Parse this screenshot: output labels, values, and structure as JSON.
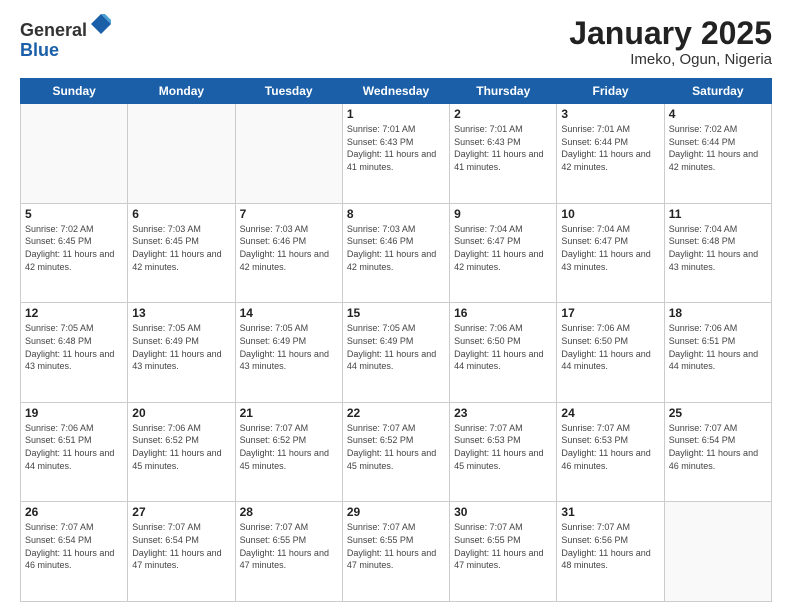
{
  "header": {
    "logo_general": "General",
    "logo_blue": "Blue",
    "title": "January 2025",
    "subtitle": "Imeko, Ogun, Nigeria"
  },
  "weekdays": [
    "Sunday",
    "Monday",
    "Tuesday",
    "Wednesday",
    "Thursday",
    "Friday",
    "Saturday"
  ],
  "weeks": [
    [
      {
        "day": "",
        "info": ""
      },
      {
        "day": "",
        "info": ""
      },
      {
        "day": "",
        "info": ""
      },
      {
        "day": "1",
        "info": "Sunrise: 7:01 AM\nSunset: 6:43 PM\nDaylight: 11 hours\nand 41 minutes."
      },
      {
        "day": "2",
        "info": "Sunrise: 7:01 AM\nSunset: 6:43 PM\nDaylight: 11 hours\nand 41 minutes."
      },
      {
        "day": "3",
        "info": "Sunrise: 7:01 AM\nSunset: 6:44 PM\nDaylight: 11 hours\nand 42 minutes."
      },
      {
        "day": "4",
        "info": "Sunrise: 7:02 AM\nSunset: 6:44 PM\nDaylight: 11 hours\nand 42 minutes."
      }
    ],
    [
      {
        "day": "5",
        "info": "Sunrise: 7:02 AM\nSunset: 6:45 PM\nDaylight: 11 hours\nand 42 minutes."
      },
      {
        "day": "6",
        "info": "Sunrise: 7:03 AM\nSunset: 6:45 PM\nDaylight: 11 hours\nand 42 minutes."
      },
      {
        "day": "7",
        "info": "Sunrise: 7:03 AM\nSunset: 6:46 PM\nDaylight: 11 hours\nand 42 minutes."
      },
      {
        "day": "8",
        "info": "Sunrise: 7:03 AM\nSunset: 6:46 PM\nDaylight: 11 hours\nand 42 minutes."
      },
      {
        "day": "9",
        "info": "Sunrise: 7:04 AM\nSunset: 6:47 PM\nDaylight: 11 hours\nand 42 minutes."
      },
      {
        "day": "10",
        "info": "Sunrise: 7:04 AM\nSunset: 6:47 PM\nDaylight: 11 hours\nand 43 minutes."
      },
      {
        "day": "11",
        "info": "Sunrise: 7:04 AM\nSunset: 6:48 PM\nDaylight: 11 hours\nand 43 minutes."
      }
    ],
    [
      {
        "day": "12",
        "info": "Sunrise: 7:05 AM\nSunset: 6:48 PM\nDaylight: 11 hours\nand 43 minutes."
      },
      {
        "day": "13",
        "info": "Sunrise: 7:05 AM\nSunset: 6:49 PM\nDaylight: 11 hours\nand 43 minutes."
      },
      {
        "day": "14",
        "info": "Sunrise: 7:05 AM\nSunset: 6:49 PM\nDaylight: 11 hours\nand 43 minutes."
      },
      {
        "day": "15",
        "info": "Sunrise: 7:05 AM\nSunset: 6:49 PM\nDaylight: 11 hours\nand 44 minutes."
      },
      {
        "day": "16",
        "info": "Sunrise: 7:06 AM\nSunset: 6:50 PM\nDaylight: 11 hours\nand 44 minutes."
      },
      {
        "day": "17",
        "info": "Sunrise: 7:06 AM\nSunset: 6:50 PM\nDaylight: 11 hours\nand 44 minutes."
      },
      {
        "day": "18",
        "info": "Sunrise: 7:06 AM\nSunset: 6:51 PM\nDaylight: 11 hours\nand 44 minutes."
      }
    ],
    [
      {
        "day": "19",
        "info": "Sunrise: 7:06 AM\nSunset: 6:51 PM\nDaylight: 11 hours\nand 44 minutes."
      },
      {
        "day": "20",
        "info": "Sunrise: 7:06 AM\nSunset: 6:52 PM\nDaylight: 11 hours\nand 45 minutes."
      },
      {
        "day": "21",
        "info": "Sunrise: 7:07 AM\nSunset: 6:52 PM\nDaylight: 11 hours\nand 45 minutes."
      },
      {
        "day": "22",
        "info": "Sunrise: 7:07 AM\nSunset: 6:52 PM\nDaylight: 11 hours\nand 45 minutes."
      },
      {
        "day": "23",
        "info": "Sunrise: 7:07 AM\nSunset: 6:53 PM\nDaylight: 11 hours\nand 45 minutes."
      },
      {
        "day": "24",
        "info": "Sunrise: 7:07 AM\nSunset: 6:53 PM\nDaylight: 11 hours\nand 46 minutes."
      },
      {
        "day": "25",
        "info": "Sunrise: 7:07 AM\nSunset: 6:54 PM\nDaylight: 11 hours\nand 46 minutes."
      }
    ],
    [
      {
        "day": "26",
        "info": "Sunrise: 7:07 AM\nSunset: 6:54 PM\nDaylight: 11 hours\nand 46 minutes."
      },
      {
        "day": "27",
        "info": "Sunrise: 7:07 AM\nSunset: 6:54 PM\nDaylight: 11 hours\nand 47 minutes."
      },
      {
        "day": "28",
        "info": "Sunrise: 7:07 AM\nSunset: 6:55 PM\nDaylight: 11 hours\nand 47 minutes."
      },
      {
        "day": "29",
        "info": "Sunrise: 7:07 AM\nSunset: 6:55 PM\nDaylight: 11 hours\nand 47 minutes."
      },
      {
        "day": "30",
        "info": "Sunrise: 7:07 AM\nSunset: 6:55 PM\nDaylight: 11 hours\nand 47 minutes."
      },
      {
        "day": "31",
        "info": "Sunrise: 7:07 AM\nSunset: 6:56 PM\nDaylight: 11 hours\nand 48 minutes."
      },
      {
        "day": "",
        "info": ""
      }
    ]
  ]
}
